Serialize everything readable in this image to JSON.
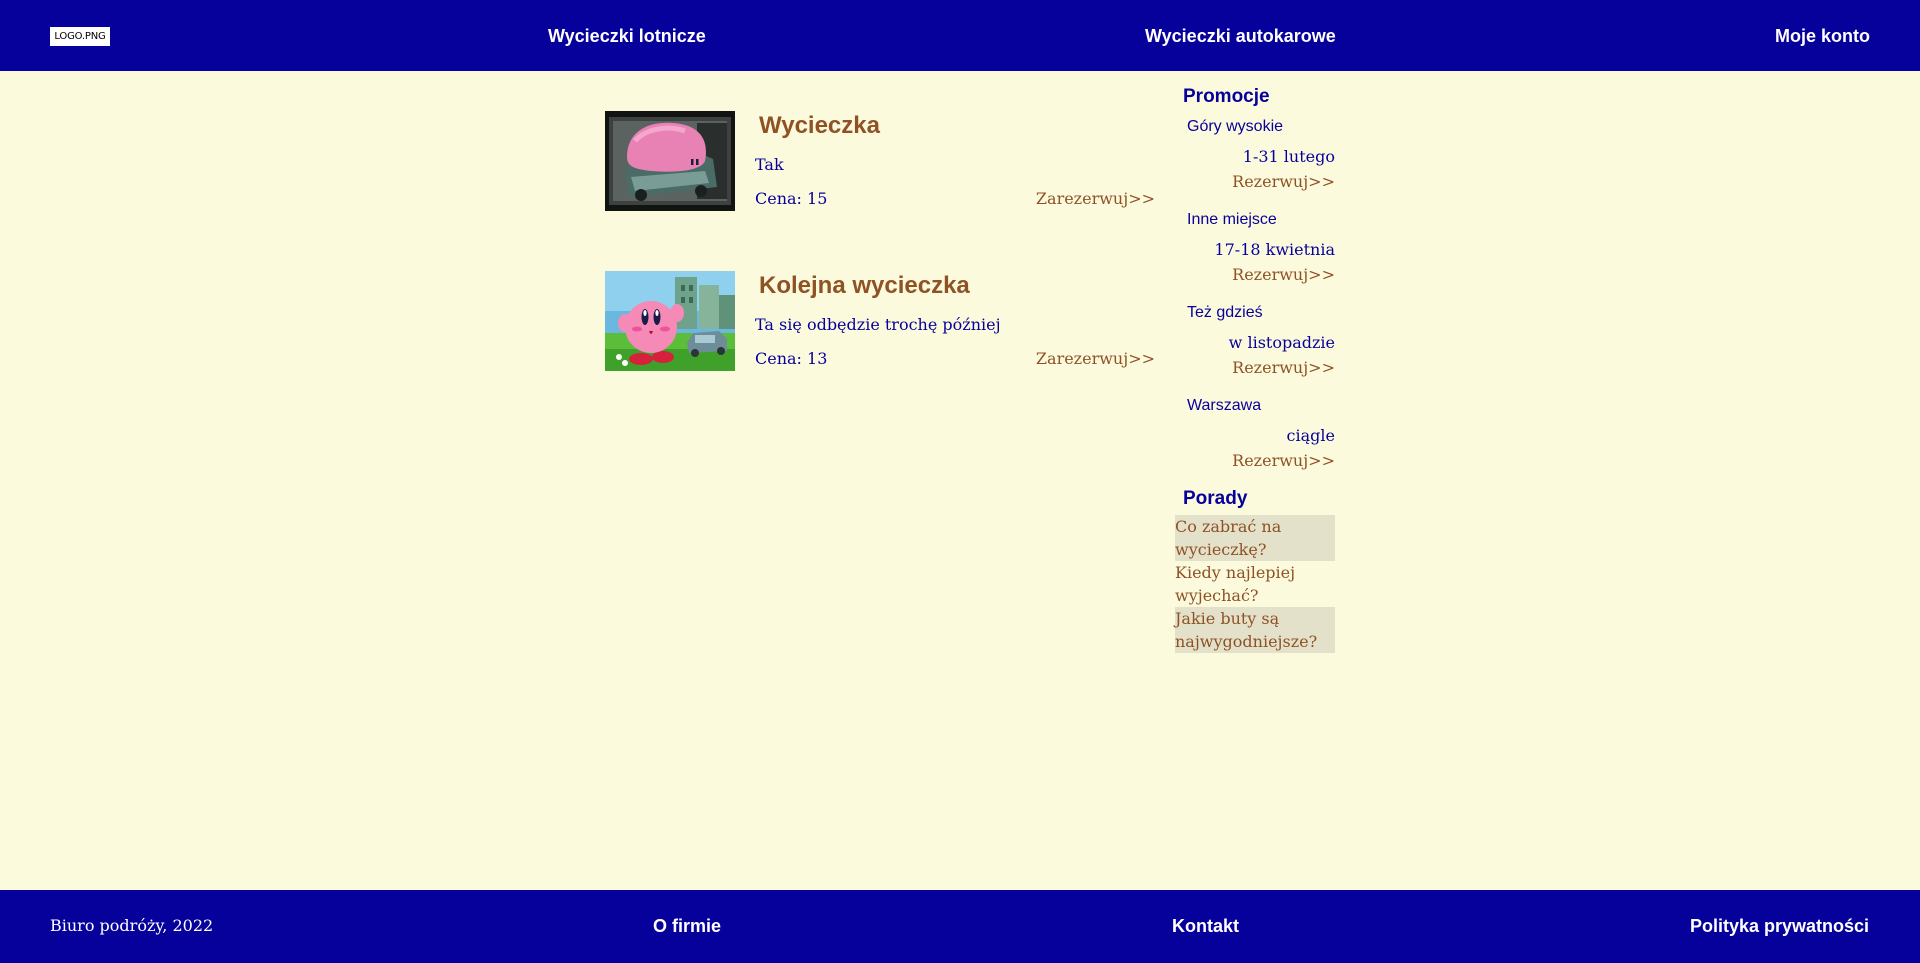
{
  "header": {
    "logo_text": "LOGO.PNG",
    "nav": [
      {
        "label": "Wycieczki lotnicze"
      },
      {
        "label": "Wycieczki autokarowe"
      },
      {
        "label": "Moje konto"
      }
    ]
  },
  "trips": [
    {
      "image_icon": "pink-blob-car-photo",
      "title": "Wycieczka",
      "description": "Tak",
      "price": "Cena: 15",
      "book_label": "Zarezerwuj>>"
    },
    {
      "image_icon": "kirby-city-photo",
      "title": "Kolejna wycieczka",
      "description": "Ta się odbędzie trochę później",
      "price": "Cena: 13",
      "book_label": "Zarezerwuj>>"
    }
  ],
  "sidebar": {
    "promo_heading": "Promocje",
    "promos": [
      {
        "place": "Góry wysokie",
        "date": "1-31 lutego",
        "book_label": "Rezerwuj>>"
      },
      {
        "place": "Inne miejsce",
        "date": "17-18 kwietnia",
        "book_label": "Rezerwuj>>"
      },
      {
        "place": "Też gdzieś",
        "date": "w listopadzie",
        "book_label": "Rezerwuj>>"
      },
      {
        "place": "Warszawa",
        "date": "ciągle",
        "book_label": "Rezerwuj>>"
      }
    ],
    "tips_heading": "Porady",
    "tips": [
      {
        "label": "Co zabrać na wycieczkę?"
      },
      {
        "label": "Kiedy najlepiej wyjechać?"
      },
      {
        "label": "Jakie buty są najwygodniejsze?"
      }
    ]
  },
  "footer": {
    "copyright": "Biuro podróży, 2022",
    "links": [
      {
        "label": "O firmie"
      },
      {
        "label": "Kontakt"
      },
      {
        "label": "Polityka prywatności"
      }
    ]
  },
  "colors": {
    "navy": "#07019c",
    "background": "#fcfadc",
    "accent_brown": "#8e5225",
    "tip_shade": "#e4e1cb"
  }
}
